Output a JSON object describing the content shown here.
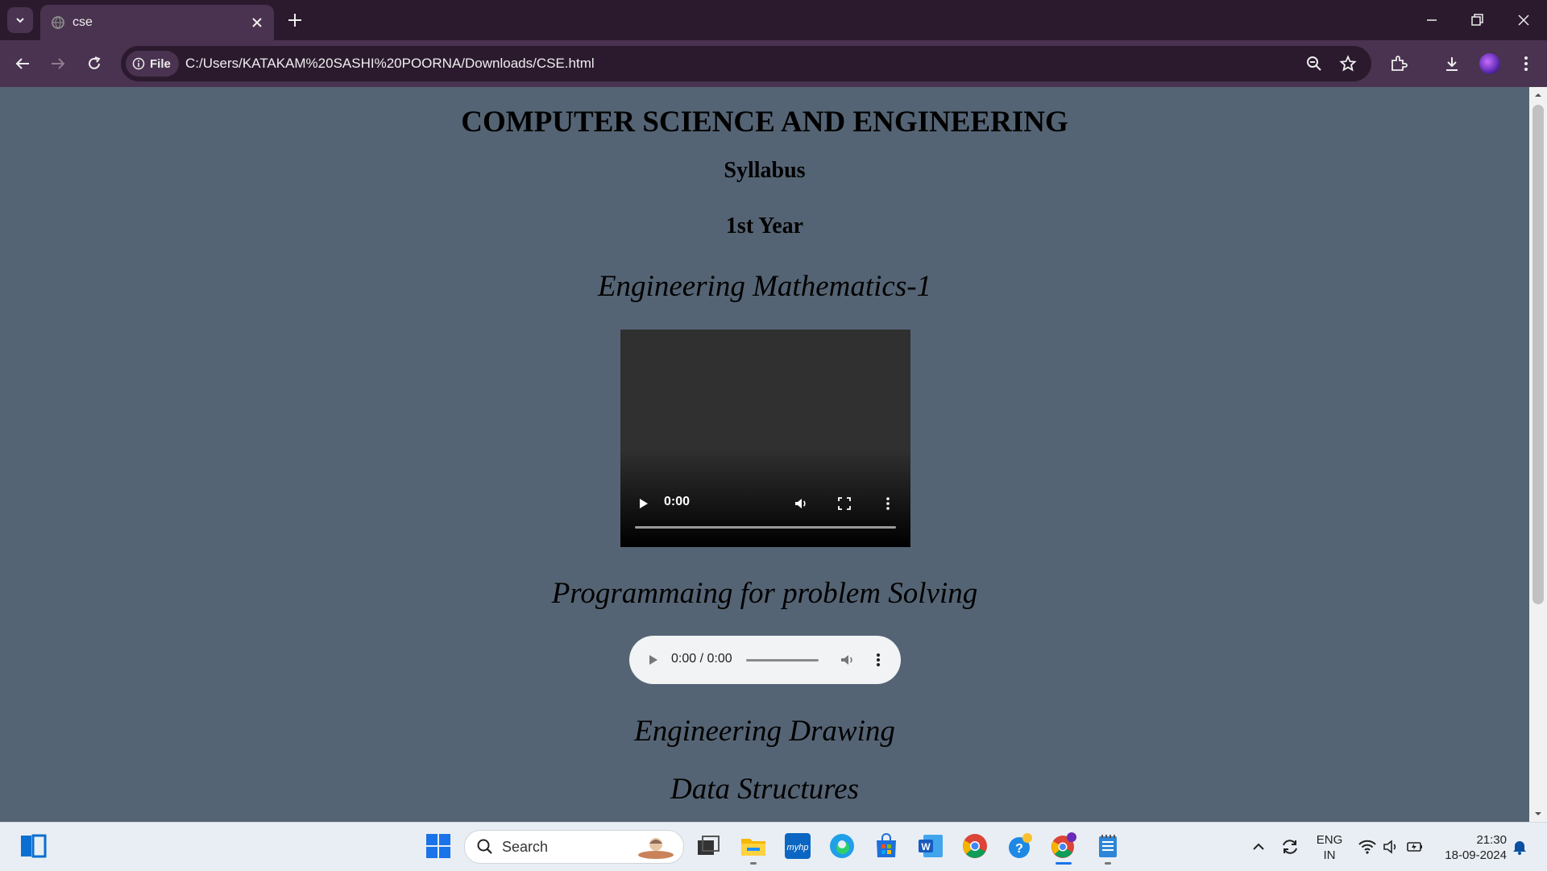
{
  "browser": {
    "tab": {
      "title": "cse"
    },
    "address_bar": {
      "chip_label": "File",
      "url": "C:/Users/KATAKAM%20SASHI%20POORNA/Downloads/CSE.html"
    }
  },
  "page": {
    "title": "COMPUTER SCIENCE AND ENGINEERING",
    "heading_syllabus": "Syllabus",
    "heading_year": "1st Year",
    "subjects": [
      "Engineering Mathematics-1",
      "Programmaing for problem Solving",
      "Engineering Drawing",
      "Data Structures"
    ],
    "video": {
      "time": "0:00"
    },
    "audio": {
      "time": "0:00 / 0:00"
    }
  },
  "taskbar": {
    "search_placeholder": "Search",
    "language": {
      "line1": "ENG",
      "line2": "IN"
    },
    "clock": {
      "time": "21:30",
      "date": "18-09-2024"
    }
  },
  "colors": {
    "page_bg": "#556474",
    "chrome_dark": "#2b1a2e",
    "chrome_mid": "#4a3350"
  }
}
